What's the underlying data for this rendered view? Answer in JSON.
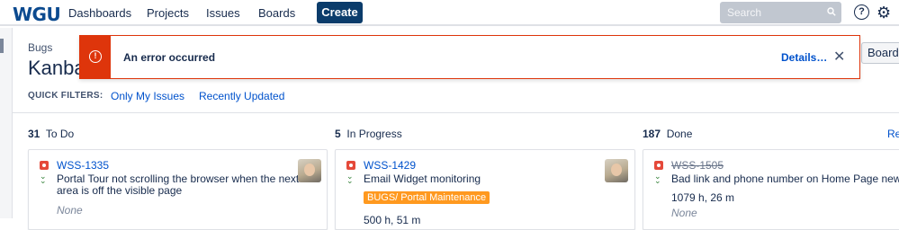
{
  "nav": {
    "logo": "WGU",
    "links": [
      "Dashboards",
      "Projects",
      "Issues",
      "Boards"
    ],
    "create_label": "Create",
    "search_placeholder": "Search",
    "help_glyph": "?",
    "settings_glyph": "⚙"
  },
  "header": {
    "breadcrumb": "Bugs",
    "title": "Kanban",
    "board_button": "Board"
  },
  "quick_filters": {
    "label": "QUICK FILTERS:",
    "items": [
      "Only My Issues",
      "Recently Updated"
    ]
  },
  "flag": {
    "icon_glyph": "!",
    "message": "An error occurred",
    "details_label": "Details…",
    "close_glyph": "✕"
  },
  "columns": [
    {
      "count": "31",
      "name": "To Do"
    },
    {
      "count": "5",
      "name": "In Progress"
    },
    {
      "count": "187",
      "name": "Done"
    }
  ],
  "release_label": "Re",
  "cards": [
    {
      "key": "WSS-1335",
      "summary_line1": "Portal Tour not scrolling the browser when the next",
      "summary_line2": "area is off the visible page",
      "estimate_placeholder": "None"
    },
    {
      "key": "WSS-1429",
      "summary_line1": "Email Widget monitoring",
      "epic": "BUGS/ Portal Maintenance",
      "estimate": "500 h, 51 m"
    },
    {
      "key": "WSS-1505",
      "summary_line1": "Bad link and phone number on Home Page news.",
      "estimate": "1079 h, 26 m",
      "estimate_placeholder": "None"
    }
  ],
  "colors": {
    "brand": "#0b4a8f",
    "create": "#0b3c6b",
    "error": "#de350b",
    "link": "#0052cc",
    "epic": "#ff991f",
    "bug": "#e5493a"
  },
  "icons": [
    "search-icon",
    "help-icon",
    "gear-icon",
    "error-icon",
    "close-icon",
    "bug-icon",
    "priority-low-icon"
  ]
}
